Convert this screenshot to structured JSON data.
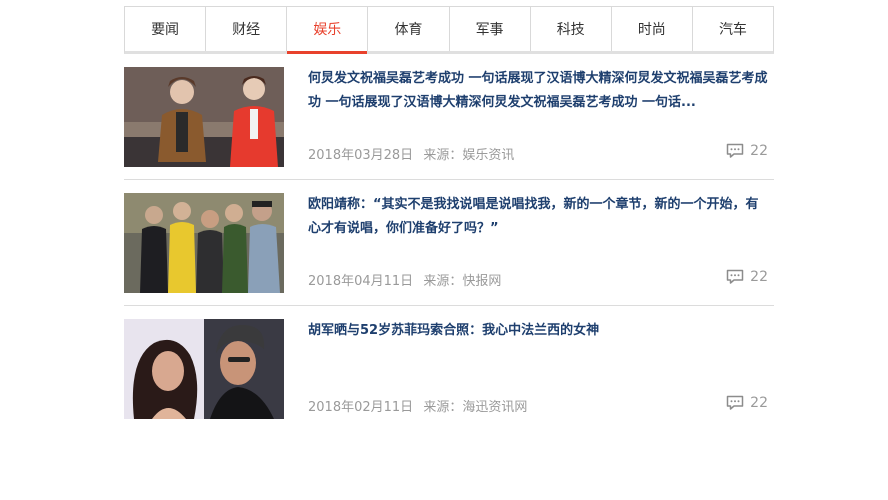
{
  "tabs": [
    {
      "label": "要闻",
      "active": false
    },
    {
      "label": "财经",
      "active": false
    },
    {
      "label": "娱乐",
      "active": true
    },
    {
      "label": "体育",
      "active": false
    },
    {
      "label": "军事",
      "active": false
    },
    {
      "label": "科技",
      "active": false
    },
    {
      "label": "时尚",
      "active": false
    },
    {
      "label": "汽车",
      "active": false
    }
  ],
  "colors": {
    "accent": "#e8412c",
    "title": "#1e3f6e",
    "meta": "#9a9a9a"
  },
  "news": [
    {
      "title": "何炅发文祝福吴磊艺考成功 一句话展现了汉语博大精深何炅发文祝福吴磊艺考成功 一句话展现了汉语博大精深何炅发文祝福吴磊艺考成功 一句话...",
      "date": "2018年03月28日",
      "source": "来源：娱乐资讯",
      "comments": "22",
      "icon": "comment-icon"
    },
    {
      "title": "欧阳靖称：“其实不是我找说唱是说唱找我，新的一个章节，新的一个开始，有心才有说唱，你们准备好了吗？”",
      "date": "2018年04月11日",
      "source": "来源：快报网",
      "comments": "22",
      "icon": "comment-icon"
    },
    {
      "title": "胡军晒与52岁苏菲玛索合照：我心中法兰西的女神",
      "date": "2018年02月11日",
      "source": "来源：海迅资讯网",
      "comments": "22",
      "icon": "comment-icon"
    }
  ]
}
